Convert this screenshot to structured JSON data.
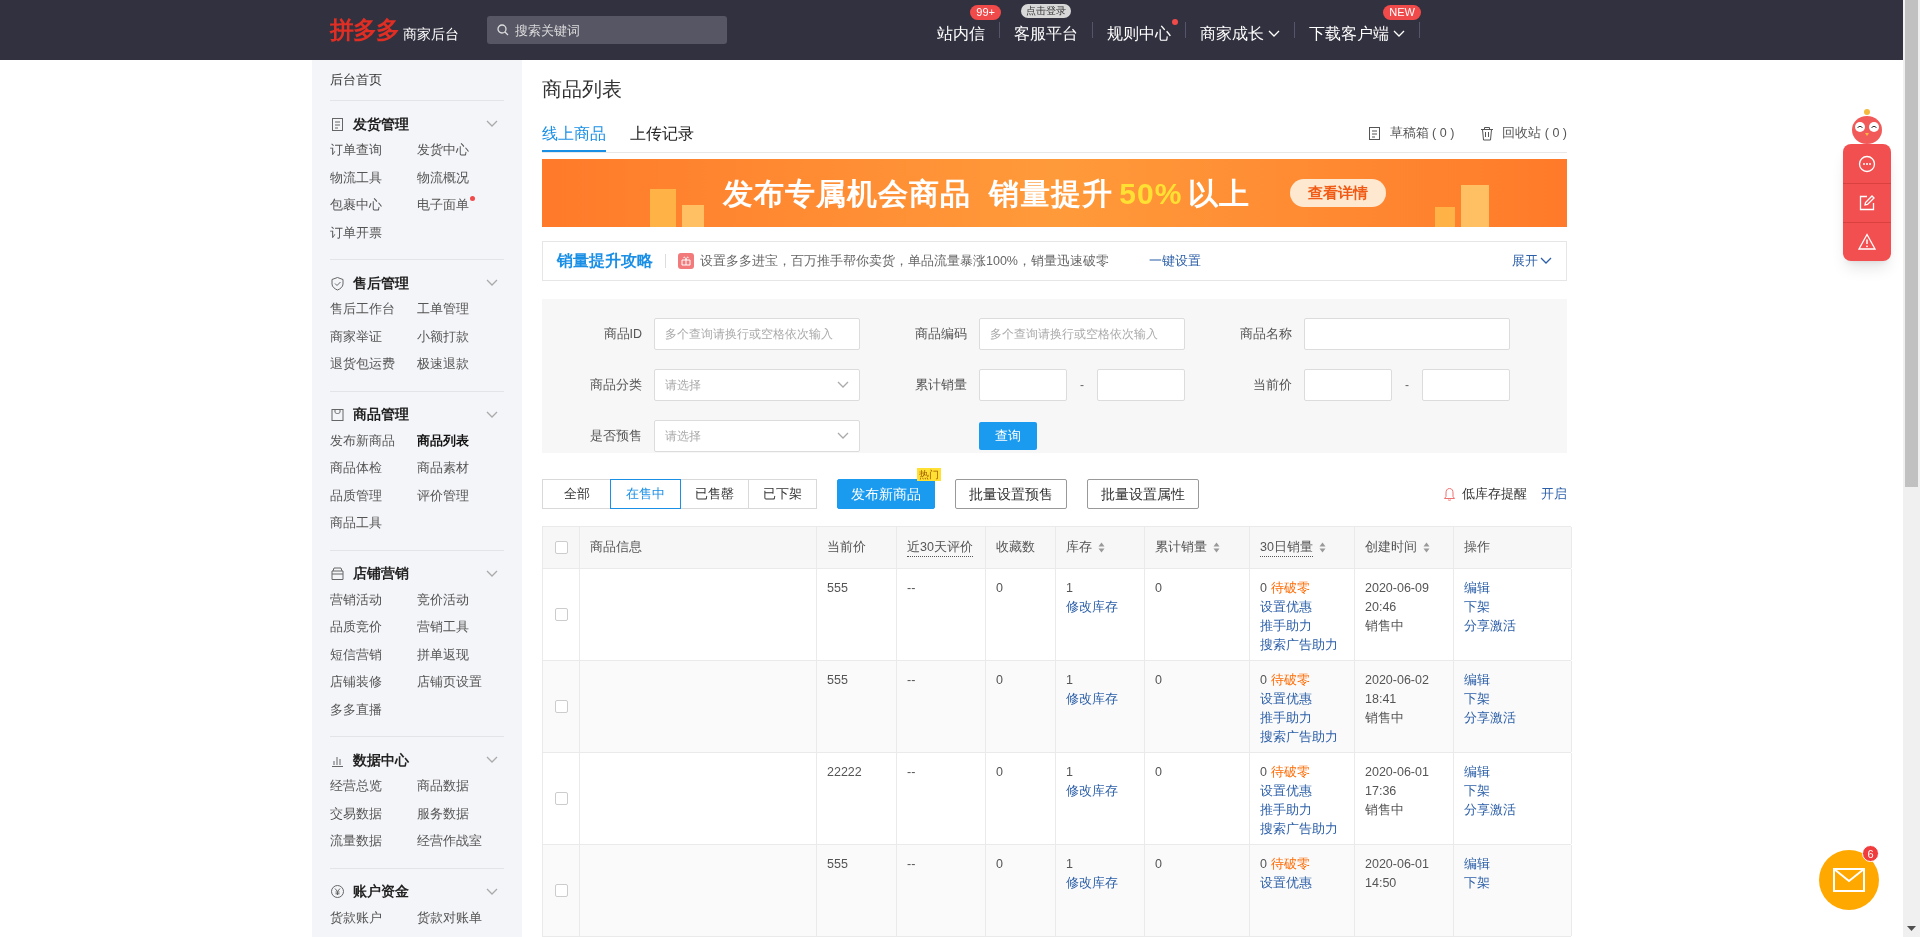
{
  "header": {
    "logo_mark": "拼多多",
    "logo_text": "商家后台",
    "search": {
      "placeholder": "搜索关键词"
    },
    "nav": [
      {
        "label": "站内信",
        "badge": {
          "text": "99+",
          "kind": "count"
        },
        "dot": false,
        "dropdown": false
      },
      {
        "label": "客服平台",
        "badge": {
          "text": "点击登录",
          "kind": "hint"
        },
        "dot": false,
        "dropdown": false
      },
      {
        "label": "规则中心",
        "dot": true,
        "dropdown": false
      },
      {
        "label": "商家成长",
        "dot": false,
        "dropdown": true
      },
      {
        "label": "下载客户端",
        "badge": {
          "text": "NEW",
          "kind": "count"
        },
        "dot": false,
        "dropdown": true
      }
    ]
  },
  "sidebar": {
    "home": "后台首页",
    "groups": [
      {
        "title": "发货管理",
        "items": [
          {
            "label": "订单查询",
            "selected": false,
            "dot": false
          },
          {
            "label": "发货中心",
            "selected": false,
            "dot": false
          },
          {
            "label": "物流工具",
            "selected": false,
            "dot": false
          },
          {
            "label": "物流概况",
            "selected": false,
            "dot": false
          },
          {
            "label": "包裹中心",
            "selected": false,
            "dot": false
          },
          {
            "label": "电子面单",
            "selected": false,
            "dot": true
          },
          {
            "label": "订单开票",
            "selected": false,
            "dot": false
          }
        ]
      },
      {
        "title": "售后管理",
        "items": [
          {
            "label": "售后工作台",
            "selected": false,
            "dot": false
          },
          {
            "label": "工单管理",
            "selected": false,
            "dot": false
          },
          {
            "label": "商家举证",
            "selected": false,
            "dot": false
          },
          {
            "label": "小额打款",
            "selected": false,
            "dot": false
          },
          {
            "label": "退货包运费",
            "selected": false,
            "dot": false
          },
          {
            "label": "极速退款",
            "selected": false,
            "dot": false
          }
        ]
      },
      {
        "title": "商品管理",
        "items": [
          {
            "label": "发布新商品",
            "selected": false,
            "dot": false
          },
          {
            "label": "商品列表",
            "selected": true,
            "dot": false
          },
          {
            "label": "商品体检",
            "selected": false,
            "dot": false
          },
          {
            "label": "商品素材",
            "selected": false,
            "dot": false
          },
          {
            "label": "品质管理",
            "selected": false,
            "dot": false
          },
          {
            "label": "评价管理",
            "selected": false,
            "dot": false
          },
          {
            "label": "商品工具",
            "selected": false,
            "dot": false
          }
        ]
      },
      {
        "title": "店铺营销",
        "items": [
          {
            "label": "营销活动",
            "selected": false,
            "dot": false
          },
          {
            "label": "竞价活动",
            "selected": false,
            "dot": false
          },
          {
            "label": "品质竞价",
            "selected": false,
            "dot": false
          },
          {
            "label": "营销工具",
            "selected": false,
            "dot": false
          },
          {
            "label": "短信营销",
            "selected": false,
            "dot": false
          },
          {
            "label": "拼单返现",
            "selected": false,
            "dot": false
          },
          {
            "label": "店铺装修",
            "selected": false,
            "dot": false
          },
          {
            "label": "店铺页设置",
            "selected": false,
            "dot": false
          },
          {
            "label": "多多直播",
            "selected": false,
            "dot": false
          }
        ]
      },
      {
        "title": "数据中心",
        "items": [
          {
            "label": "经营总览",
            "selected": false,
            "dot": false
          },
          {
            "label": "商品数据",
            "selected": false,
            "dot": false
          },
          {
            "label": "交易数据",
            "selected": false,
            "dot": false
          },
          {
            "label": "服务数据",
            "selected": false,
            "dot": false
          },
          {
            "label": "流量数据",
            "selected": false,
            "dot": false
          },
          {
            "label": "经营作战室",
            "selected": false,
            "dot": false
          }
        ]
      },
      {
        "title": "账户资金",
        "items": [
          {
            "label": "货款账户",
            "selected": false,
            "dot": false
          },
          {
            "label": "货款对账单",
            "selected": false,
            "dot": false
          }
        ]
      }
    ]
  },
  "page": {
    "title": "商品列表",
    "tabs": [
      {
        "label": "线上商品",
        "selected": true
      },
      {
        "label": "上传记录",
        "selected": false
      }
    ],
    "tab_actions": [
      {
        "label": "草稿箱 ( 0 )"
      },
      {
        "label": "回收站 ( 0 )"
      }
    ],
    "banner": {
      "headline": "发布专属机会商品  销量提升",
      "highlight": "50%",
      "suffix": "以上",
      "button": "查看详情"
    },
    "strategy": {
      "title": "销量提升攻略",
      "text": "设置多多进宝，百万推手帮你卖货，单品流量暴涨100%，销量迅速破零",
      "link": "一键设置",
      "toggle": "展开"
    },
    "filters": [
      {
        "label": "商品ID",
        "kind": "text",
        "placeholder": "多个查询请换行或空格依次输入"
      },
      {
        "label": "商品编码",
        "kind": "text",
        "placeholder": "多个查询请换行或空格依次输入"
      },
      {
        "label": "商品名称",
        "kind": "text"
      },
      {
        "label": "商品分类",
        "kind": "select",
        "placeholder": "请选择"
      },
      {
        "label": "累计销量",
        "kind": "range",
        "separator": "-"
      },
      {
        "label": "当前价",
        "kind": "range",
        "separator": "-"
      },
      {
        "label": "是否预售",
        "kind": "select",
        "placeholder": "请选择"
      },
      {
        "kind": "button",
        "label": "查询"
      }
    ],
    "status_filter": [
      {
        "label": "全部",
        "selected": false
      },
      {
        "label": "在售中",
        "selected": true
      },
      {
        "label": "已售罄",
        "selected": false
      },
      {
        "label": "已下架",
        "selected": false
      }
    ],
    "actions": [
      {
        "label": "发布新商品",
        "kind": "primary",
        "badge": "热门"
      },
      {
        "label": "批量设置预售",
        "kind": "outline"
      },
      {
        "label": "批量设置属性",
        "kind": "outline"
      }
    ],
    "low_stock": {
      "label": "低库存提醒",
      "link": "开启"
    },
    "table": {
      "select_all_checked": false,
      "columns": [
        {
          "label": "商品信息",
          "sortable": false,
          "hint": false
        },
        {
          "label": "当前价",
          "sortable": false,
          "hint": false
        },
        {
          "label": "近30天评价",
          "sortable": false,
          "hint": true
        },
        {
          "label": "收藏数",
          "sortable": false,
          "hint": false
        },
        {
          "label": "库存",
          "sortable": true,
          "hint": false
        },
        {
          "label": "累计销量",
          "sortable": true,
          "hint": false
        },
        {
          "label": "30日销量",
          "sortable": true,
          "hint": true
        },
        {
          "label": "创建时间",
          "sortable": true,
          "hint": false
        },
        {
          "label": "操作",
          "sortable": false,
          "hint": false
        }
      ],
      "rows": [
        {
          "checked": false,
          "price": "555",
          "rating": "--",
          "favorites": "0",
          "stock": "1",
          "stock_link": "修改库存",
          "total_sales": "0",
          "sales_30d": "0",
          "sales_status": "待破零",
          "sales_links": [
            "设置优惠",
            "推手助力",
            "搜索广告助力"
          ],
          "created_date": "2020-06-09",
          "created_time": "20:46",
          "state": "销售中",
          "operations": [
            "编辑",
            "下架",
            "分享激活"
          ]
        },
        {
          "checked": false,
          "price": "555",
          "rating": "--",
          "favorites": "0",
          "stock": "1",
          "stock_link": "修改库存",
          "total_sales": "0",
          "sales_30d": "0",
          "sales_status": "待破零",
          "sales_links": [
            "设置优惠",
            "推手助力",
            "搜索广告助力"
          ],
          "created_date": "2020-06-02",
          "created_time": "18:41",
          "state": "销售中",
          "operations": [
            "编辑",
            "下架",
            "分享激活"
          ]
        },
        {
          "checked": false,
          "price": "22222",
          "rating": "--",
          "favorites": "0",
          "stock": "1",
          "stock_link": "修改库存",
          "total_sales": "0",
          "sales_30d": "0",
          "sales_status": "待破零",
          "sales_links": [
            "设置优惠",
            "推手助力",
            "搜索广告助力"
          ],
          "created_date": "2020-06-01",
          "created_time": "17:36",
          "state": "销售中",
          "operations": [
            "编辑",
            "下架",
            "分享激活"
          ]
        },
        {
          "checked": false,
          "price": "555",
          "rating": "--",
          "favorites": "0",
          "stock": "1",
          "stock_link": "修改库存",
          "total_sales": "0",
          "sales_30d": "0",
          "sales_status": "待破零",
          "sales_links": [
            "设置优惠"
          ],
          "created_date": "2020-06-01",
          "created_time": "14:50",
          "operations": [
            "编辑",
            "下架"
          ]
        }
      ]
    }
  },
  "floating": {
    "mail_badge": "6"
  }
}
